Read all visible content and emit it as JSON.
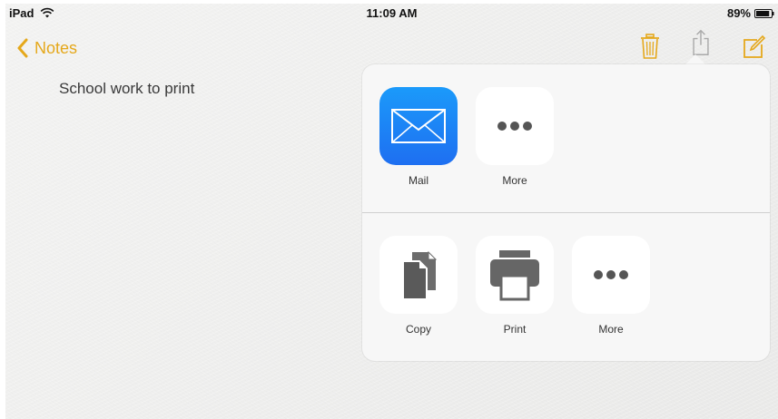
{
  "status_bar": {
    "device": "iPad",
    "time": "11:09 AM",
    "battery": "89%",
    "battery_level": 0.89
  },
  "nav": {
    "back_label": "Notes"
  },
  "note": {
    "text": "School work to print"
  },
  "share_sheet": {
    "apps": [
      {
        "label": "Mail",
        "icon": "mail-icon"
      },
      {
        "label": "More",
        "icon": "more-dots-icon"
      }
    ],
    "actions": [
      {
        "label": "Copy",
        "icon": "copy-icon"
      },
      {
        "label": "Print",
        "icon": "printer-icon"
      },
      {
        "label": "More",
        "icon": "more-dots-icon"
      }
    ]
  },
  "colors": {
    "accent": "#e5a81b",
    "mail_gradient_top": "#1b9afa",
    "mail_gradient_bottom": "#1e6ff1"
  }
}
